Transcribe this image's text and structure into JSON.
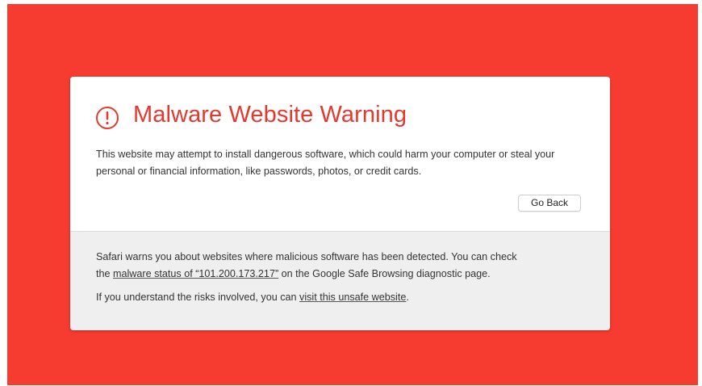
{
  "colors": {
    "background": "#f63b30",
    "title": "#e4392f",
    "card_top": "#ffffff",
    "card_bottom": "#efefef"
  },
  "warning": {
    "icon": "exclamation-circle-icon",
    "title": "Malware Website Warning",
    "description": "This website may attempt to install dangerous software, which could harm your computer or steal your personal or financial information, like passwords, photos, or credit cards.",
    "go_back_label": "Go Back"
  },
  "details": {
    "line1_before": "Safari warns you about websites where malicious software has been detected. You can check",
    "line1_the": "the ",
    "malware_status_link": "malware status of “101.200.173.217”",
    "line1_after": " on the Google Safe Browsing diagnostic page.",
    "line2_before": "If you understand the risks involved, you can ",
    "visit_link": "visit this unsafe website",
    "line2_after": "."
  }
}
